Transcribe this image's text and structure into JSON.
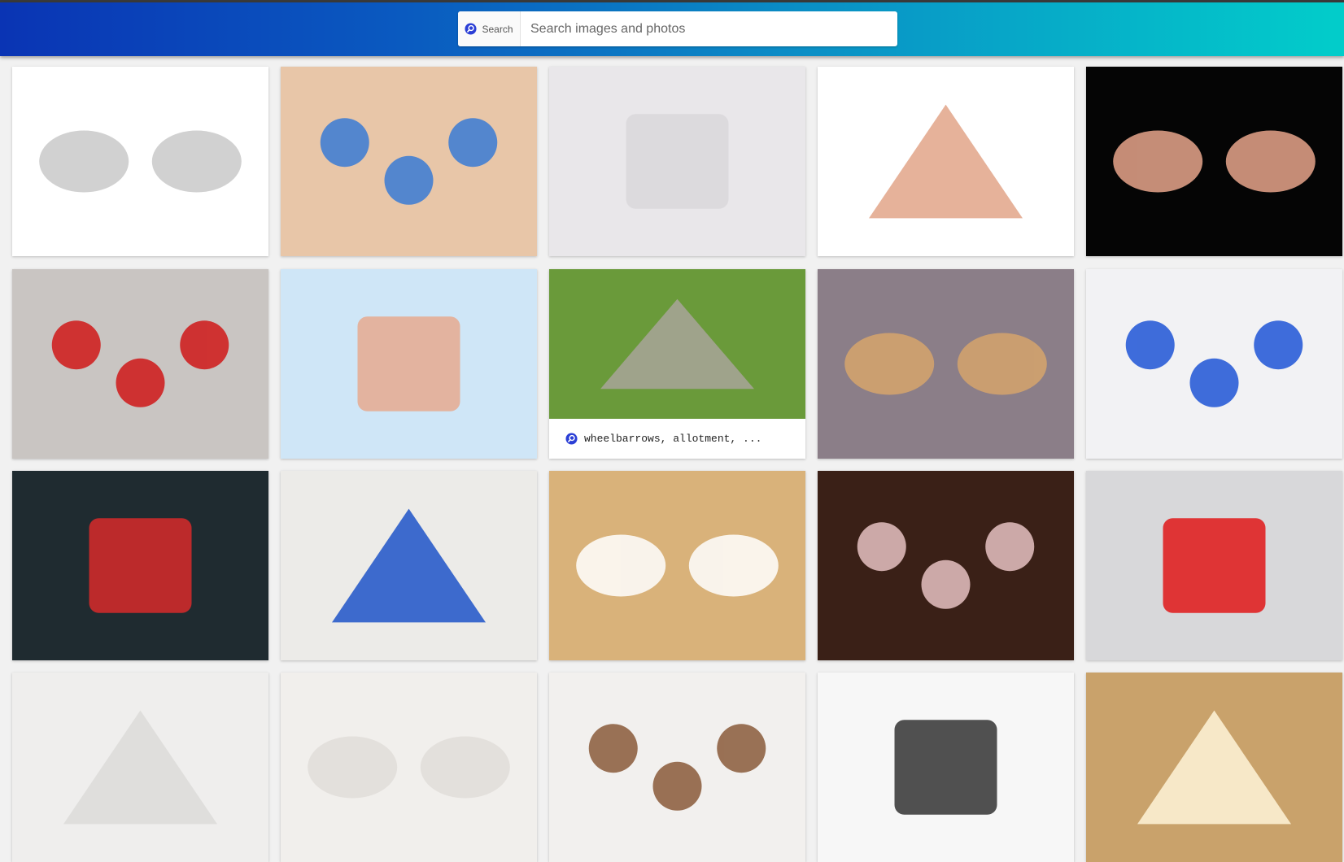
{
  "header": {
    "search_label": "Search",
    "search_placeholder": "Search images and photos",
    "search_value": ""
  },
  "colors": {
    "brand_accent": "#2b3fd6",
    "header_gradient_start": "#0a34b4",
    "header_gradient_end": "#02cdca"
  },
  "results": [
    {
      "name": "hands-puzzle-gray",
      "bg": "#ffffff",
      "accent": "#c9c9c9"
    },
    {
      "name": "stacked-hands-colorful",
      "bg": "#e8c6a8",
      "accent": "#3a7bd5"
    },
    {
      "name": "white-puzzle-closeup",
      "bg": "#e9e7ea",
      "accent": "#d9d7da"
    },
    {
      "name": "hands-puzzle-color",
      "bg": "#ffffff",
      "accent": "#e2a488"
    },
    {
      "name": "hands-puzzle-black",
      "bg": "#050505",
      "accent": "#e7a58b"
    },
    {
      "name": "red-hearts",
      "bg": "#c9c5c2",
      "accent": "#d01818"
    },
    {
      "name": "hands-puzzle-blue",
      "bg": "#cfe6f7",
      "accent": "#e6a98f"
    },
    {
      "name": "garden-path",
      "bg": "#6a9a3a",
      "accent": "#a8a49a",
      "caption": "wheelbarrows, allotment, ..."
    },
    {
      "name": "wooden-mannequins",
      "bg": "#8b7e88",
      "accent": "#d6a46c"
    },
    {
      "name": "blue-yellow-figures-puzzle",
      "bg": "#f2f2f4",
      "accent": "#1f55d6"
    },
    {
      "name": "ladybugs-tic-tac-toe",
      "bg": "#1f2b30",
      "accent": "#d82a2a"
    },
    {
      "name": "blue-figure-puzzle",
      "bg": "#ecebe8",
      "accent": "#1e53c8"
    },
    {
      "name": "wooden-puzzle-piece",
      "bg": "#d9b27a",
      "accent": "#ffffff"
    },
    {
      "name": "scattered-puzzle-pieces",
      "bg": "#3a2017",
      "accent": "#e6c2c2"
    },
    {
      "name": "red-dice-ladybugs",
      "bg": "#d8d8da",
      "accent": "#e01818"
    },
    {
      "name": "white-puzzle-row4-1",
      "bg": "#efeeed",
      "accent": "#dcdad8"
    },
    {
      "name": "white-puzzle-row4-2",
      "bg": "#f1efec",
      "accent": "#e0ddd9"
    },
    {
      "name": "keyhole-puzzle",
      "bg": "#f2f0ee",
      "accent": "#8a5a3a"
    },
    {
      "name": "laptop-screen",
      "bg": "#f7f7f7",
      "accent": "#333333"
    },
    {
      "name": "lightbulb-puzzle",
      "bg": "#c9a26b",
      "accent": "#fff4d8"
    }
  ]
}
